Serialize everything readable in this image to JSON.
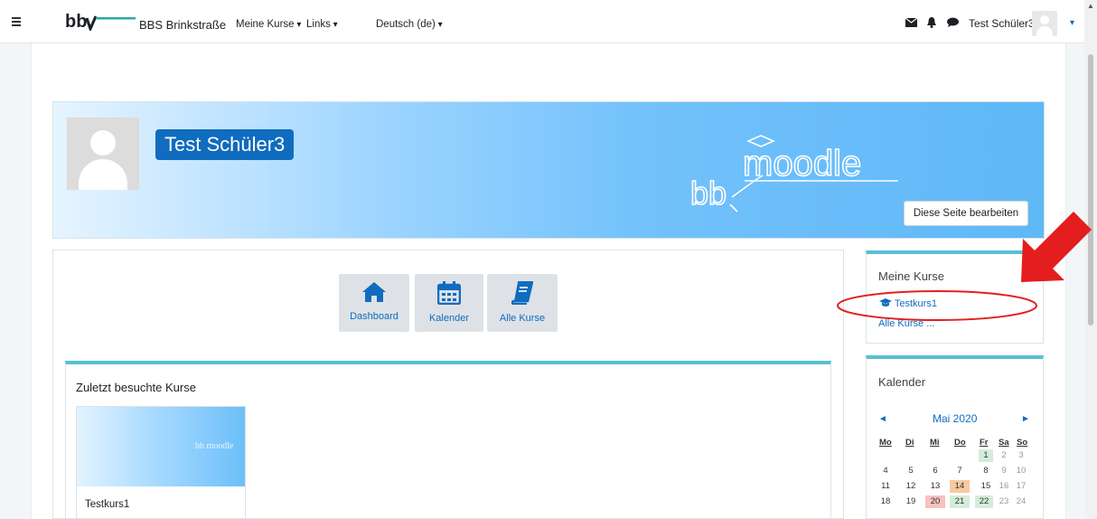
{
  "navbar": {
    "site_name": "BBS Brinkstraße",
    "menu": [
      "Meine Kurse",
      "Links",
      "Deutsch (de)"
    ],
    "user_name": "Test Schüler3"
  },
  "profile": {
    "name": "Test Schüler3",
    "edit_button": "Diese Seite bearbeiten"
  },
  "tiles": [
    {
      "label": "Dashboard",
      "icon": "home-icon"
    },
    {
      "label": "Kalender",
      "icon": "calendar-icon"
    },
    {
      "label": "Alle Kurse",
      "icon": "book-icon"
    }
  ],
  "recent": {
    "title": "Zuletzt besuchte Kurse",
    "course_name": "Testkurs1"
  },
  "my_courses": {
    "title": "Meine Kurse",
    "course": "Testkurs1",
    "all_courses": "Alle Kurse ..."
  },
  "calendar": {
    "title": "Kalender",
    "month": "Mai 2020",
    "weekdays": [
      "Mo",
      "Di",
      "Mi",
      "Do",
      "Fr",
      "Sa",
      "So"
    ],
    "rows": [
      [
        "",
        "",
        "",
        "",
        "1",
        "2",
        "3"
      ],
      [
        "4",
        "5",
        "6",
        "7",
        "8",
        "9",
        "10"
      ],
      [
        "11",
        "12",
        "13",
        "14",
        "15",
        "16",
        "17"
      ],
      [
        "18",
        "19",
        "20",
        "21",
        "22",
        "23",
        "24"
      ]
    ]
  },
  "colors": {
    "primary": "#0f6cbf",
    "block_accent": "#56c0d3",
    "annotation": "#e41e1e"
  }
}
